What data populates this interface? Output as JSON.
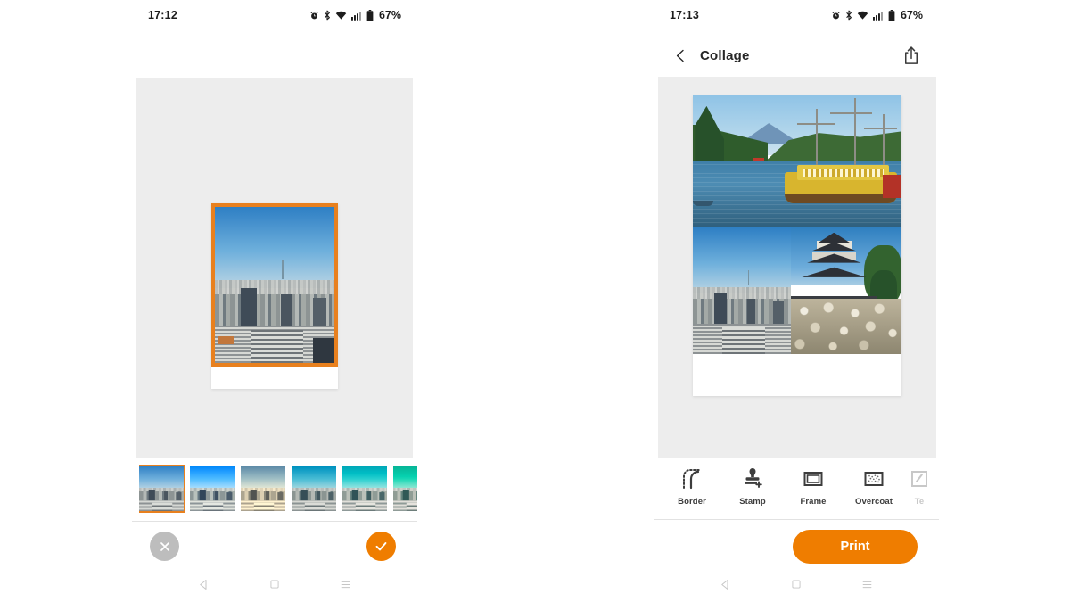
{
  "app": {
    "accent_orange": "#ef7d00",
    "selection_orange": "#e8801e",
    "stage_bg": "#ededed"
  },
  "left_panel": {
    "status_bar": {
      "time": "17:12",
      "battery_text": "67%",
      "icons": [
        "alarm-icon",
        "bluetooth-icon",
        "wifi-icon",
        "signal-icon",
        "battery-icon"
      ]
    },
    "preview": {
      "photo_description": "cityscape",
      "selected": true
    },
    "filters": [
      {
        "name": "original",
        "selected": true
      },
      {
        "name": "vivid",
        "selected": false
      },
      {
        "name": "sepia",
        "selected": false
      },
      {
        "name": "cool",
        "selected": false
      },
      {
        "name": "aqua",
        "selected": false
      },
      {
        "name": "teal",
        "selected": false
      }
    ],
    "actions": {
      "cancel_label": "cancel-button",
      "confirm_label": "confirm-button"
    },
    "nav": [
      "back-icon",
      "home-icon",
      "recents-icon"
    ]
  },
  "right_panel": {
    "status_bar": {
      "time": "17:13",
      "battery_text": "67%",
      "icons": [
        "alarm-icon",
        "bluetooth-icon",
        "wifi-icon",
        "signal-icon",
        "battery-icon"
      ]
    },
    "appbar": {
      "back_icon": "chevron-left-icon",
      "title": "Collage",
      "share_icon": "share-icon"
    },
    "collage": {
      "cells": [
        {
          "description": "pirate ship on lake"
        },
        {
          "description": "cityscape"
        },
        {
          "description": "japanese castle and stone wall"
        }
      ]
    },
    "tools": [
      {
        "label": "Border",
        "icon": "border-icon"
      },
      {
        "label": "Stamp",
        "icon": "stamp-icon"
      },
      {
        "label": "Frame",
        "icon": "frame-icon"
      },
      {
        "label": "Overcoat",
        "icon": "overcoat-icon"
      },
      {
        "label": "Te",
        "icon": "text-icon"
      }
    ],
    "print_button": "Print",
    "nav": [
      "back-icon",
      "home-icon",
      "recents-icon"
    ]
  }
}
